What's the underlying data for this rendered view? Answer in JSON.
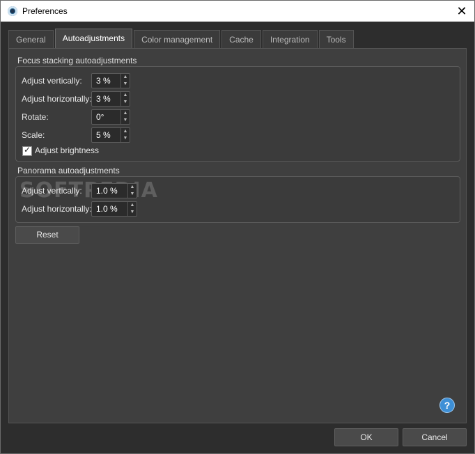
{
  "window": {
    "title": "Preferences",
    "close_glyph": "✕"
  },
  "tabs": [
    {
      "label": "General"
    },
    {
      "label": "Autoadjustments"
    },
    {
      "label": "Color management"
    },
    {
      "label": "Cache"
    },
    {
      "label": "Integration"
    },
    {
      "label": "Tools"
    }
  ],
  "focus": {
    "title": "Focus stacking autoadjustments",
    "adjust_vertically": {
      "label": "Adjust vertically:",
      "value": "3 %"
    },
    "adjust_horizontally": {
      "label": "Adjust horizontally:",
      "value": "3 %"
    },
    "rotate": {
      "label": "Rotate:",
      "value": "0°"
    },
    "scale": {
      "label": "Scale:",
      "value": "5 %"
    },
    "adjust_brightness": {
      "label": "Adjust brightness",
      "checked": true
    }
  },
  "panorama": {
    "title": "Panorama autoadjustments",
    "adjust_vertically": {
      "label": "Adjust vertically:",
      "value": "1.0 %"
    },
    "adjust_horizontally": {
      "label": "Adjust horizontally:",
      "value": "1.0 %"
    }
  },
  "reset_label": "Reset",
  "ok_label": "OK",
  "cancel_label": "Cancel",
  "help_glyph": "?",
  "watermark": "SOFTPEDIA",
  "colors": {
    "background": "#2e2e2e",
    "panel": "#3f3f3f",
    "help_accent": "#3d8fd6"
  }
}
